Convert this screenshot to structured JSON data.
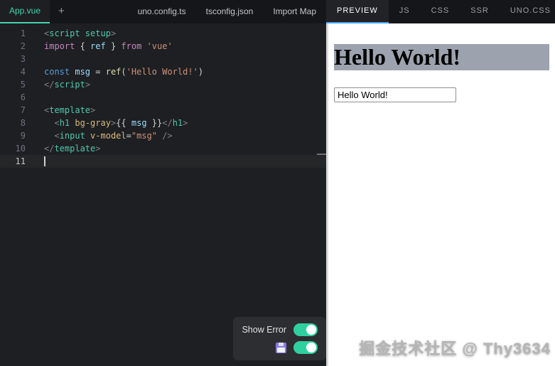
{
  "top_bar": {
    "active_file_tab": "App.vue",
    "add_tab_label": "+",
    "file_tabs": [
      "uno.config.ts",
      "tsconfig.json",
      "Import Map"
    ],
    "output_tabs": [
      "PREVIEW",
      "JS",
      "CSS",
      "SSR",
      "UNO.CSS"
    ],
    "active_output_tab": "PREVIEW"
  },
  "editor": {
    "cursor_line": 11,
    "lines": [
      [
        [
          "<",
          "p"
        ],
        [
          "script setup",
          "t"
        ],
        [
          ">",
          "p"
        ]
      ],
      [
        [
          "import",
          "k"
        ],
        [
          " { ",
          "pl"
        ],
        [
          "ref",
          "v"
        ],
        [
          " } ",
          "pl"
        ],
        [
          "from",
          "k"
        ],
        [
          " ",
          "pl"
        ],
        [
          "'vue'",
          "s"
        ]
      ],
      [],
      [
        [
          "const",
          "kb"
        ],
        [
          " ",
          "pl"
        ],
        [
          "msg",
          "v"
        ],
        [
          " = ",
          "pl"
        ],
        [
          "ref",
          "f"
        ],
        [
          "(",
          "pl"
        ],
        [
          "'Hello World!'",
          "s"
        ],
        [
          ")",
          "pl"
        ]
      ],
      [
        [
          "</",
          "p"
        ],
        [
          "script",
          "t"
        ],
        [
          ">",
          "p"
        ]
      ],
      [],
      [
        [
          "<",
          "p"
        ],
        [
          "template",
          "t"
        ],
        [
          ">",
          "p"
        ]
      ],
      [
        [
          "  ",
          "pl"
        ],
        [
          "<",
          "p"
        ],
        [
          "h1",
          "t"
        ],
        [
          " ",
          "pl"
        ],
        [
          "bg-gray",
          "a"
        ],
        [
          ">",
          "p"
        ],
        [
          "{{ ",
          "pl"
        ],
        [
          "msg",
          "v"
        ],
        [
          " }}",
          "pl"
        ],
        [
          "</",
          "p"
        ],
        [
          "h1",
          "t"
        ],
        [
          ">",
          "p"
        ]
      ],
      [
        [
          "  ",
          "pl"
        ],
        [
          "<",
          "p"
        ],
        [
          "input",
          "t"
        ],
        [
          " ",
          "pl"
        ],
        [
          "v-model",
          "a"
        ],
        [
          "=",
          "pl"
        ],
        [
          "\"msg\"",
          "s"
        ],
        [
          " />",
          "p"
        ]
      ],
      [
        [
          "</",
          "p"
        ],
        [
          "template",
          "t"
        ],
        [
          ">",
          "p"
        ]
      ],
      []
    ]
  },
  "editor_options": {
    "show_error_label": "Show Error",
    "show_error_on": true,
    "auto_save_icon": "floppy-disk",
    "auto_save_on": true
  },
  "preview": {
    "heading": "Hello World!",
    "input_value": "Hello World!",
    "watermark": "掘金技术社区 @ Thy3634"
  },
  "colors": {
    "file_accent": "#40d4ae",
    "output_accent": "#44a2f4",
    "toggle_on": "#2fd0a0",
    "heading_bg": "#9ca3af"
  }
}
